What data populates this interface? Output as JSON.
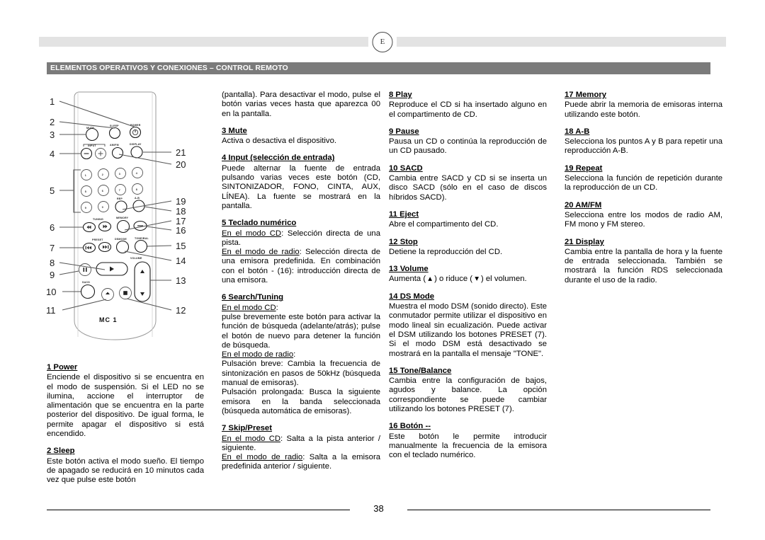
{
  "page": {
    "language_mark": "E",
    "section_title": "ELEMENTOS OPERATIVOS Y CONEXIONES – CONTROL REMOTO",
    "page_number": "38"
  },
  "figure": {
    "model_label": "MC 1",
    "callouts_left": [
      "1",
      "2",
      "3",
      "4",
      "5",
      "6",
      "7",
      "8",
      "9",
      "10",
      "11"
    ],
    "callouts_right": [
      "21",
      "20",
      "19",
      "18",
      "17",
      "16",
      "15",
      "14",
      "13",
      "12"
    ],
    "button_labels": {
      "mute": "MUTE",
      "sleep": "SLEEP",
      "power": "POWER",
      "input": "INPUT",
      "amfm": "AM/FM",
      "display": "DISPLAY",
      "rep": "REP",
      "ab": "A-B",
      "tuning": "TUNING",
      "memory": "MEMORY",
      "preset": "PRESET",
      "dsmode": "DSMODE",
      "tonebal": "TONE/BAL",
      "volume": "VOLUME",
      "sacd": "SACD",
      "minus": "-",
      "keys": [
        "1",
        "2",
        "3",
        "4",
        "5",
        "6",
        "7",
        "8",
        "9",
        "0"
      ],
      "input_minus": "−",
      "input_plus": "+"
    }
  },
  "columns": {
    "col1": {
      "entries": [
        {
          "title": "1  Power",
          "body": "Enciende el dispositivo si se encuentra en el modo de suspensión. Si el LED no se ilumina, accione el interruptor de alimentación que se encuentra en la parte posterior del dispositivo. De igual forma, le permite apagar el dispositivo si está encendido."
        },
        {
          "title": "2  Sleep",
          "body": "Este botón activa el modo sueño. El tiempo de apagado se reducirá en 10 minutos cada vez que pulse este botón"
        }
      ]
    },
    "col2": {
      "lead_text": "(pantalla). Para desactivar el modo, pulse el botón varias veces hasta que aparezca 00 en la pantalla.",
      "entries": [
        {
          "title": "3  Mute",
          "body": "Activa o desactiva el dispositivo."
        },
        {
          "title": "4  Input (selección de entrada)",
          "body": "Puede alternar la fuente de entrada pulsando varias veces este botón (CD, SINTONIZADOR, FONO, CINTA, AUX, LÍNEA). La fuente se mostrará en la pantalla."
        },
        {
          "title": "5 Teclado numérico",
          "sub1": "En el modo CD",
          "body1": ": Selección directa de una pista.",
          "sub2": "En el modo de radio",
          "body2": ": Selección directa de una emisora predefinida. En combinación con el botón - (16): introducción directa de una emisora."
        },
        {
          "title": "6  Search/Tuning",
          "sub1": "En el modo CD",
          "body1": ":",
          "para1": "pulse brevemente este botón para activar la función de búsqueda (adelante/atrás); pulse el botón de nuevo para detener la función de búsqueda.",
          "sub2": "En el modo de radio",
          "body2": ":",
          "para2": "Pulsación breve: Cambia la frecuencia de sintonización en pasos de 50kHz (búsqueda manual de emisoras).",
          "para3": "Pulsación prolongada: Busca la siguiente emisora en la banda seleccionada (búsqueda automática de emisoras)."
        },
        {
          "title": "7  Skip/Preset",
          "sub1": "En el modo CD",
          "body1": ": Salta a la pista anterior / siguiente.",
          "sub2": "En el modo de radio",
          "body2": ": Salta a la emisora predefinida anterior / siguiente."
        }
      ]
    },
    "col3": {
      "entries": [
        {
          "title": "8  Play",
          "body": "Reproduce el CD si ha insertado alguno en el compartimento de CD."
        },
        {
          "title": "9  Pause",
          "body": "Pausa un CD o continúa la reproducción de un CD pausado."
        },
        {
          "title": "10  SACD",
          "body": "Cambia entre SACD y CD si se inserta un disco SACD (sólo en el caso de discos híbridos SACD)."
        },
        {
          "title": "11  Eject",
          "body": "Abre el compartimento del CD."
        },
        {
          "title": "12  Stop",
          "body": "Detiene la reproducción del CD."
        },
        {
          "title": "13  Volume",
          "body": "Aumenta ( ▴ ) o riduce ( ▾ ) el volumen."
        },
        {
          "title": "14  DS Mode",
          "body": "Muestra el modo DSM (sonido directo). Este conmutador permite utilizar el dispositivo en modo lineal sin ecualización. Puede activar el DSM utilizando los botones PRESET (7). Si el modo DSM está desactivado se mostrará en la pantalla el mensaje \"TONE\"."
        },
        {
          "title": "15 Tone/Balance",
          "body": "Cambia entre la configuración de bajos, agudos y balance. La opción correspondiente se puede cambiar utilizando los botones PRESET (7)."
        },
        {
          "title": "16  Botón --",
          "body": "Este botón le permite introducir manualmente la frecuencia de la emisora con el teclado numérico."
        }
      ]
    },
    "col4": {
      "entries": [
        {
          "title": "17  Memory",
          "body": "Puede abrir la memoria de emisoras interna utilizando este botón."
        },
        {
          "title": "18  A-B",
          "body": "Selecciona los puntos A y B para repetir una reproducción A-B."
        },
        {
          "title": "19  Repeat",
          "body": "Selecciona la función de repetición durante la reproducción de un CD."
        },
        {
          "title": "20  AM/FM",
          "body": "Selecciona entre los modos de radio AM, FM mono y FM stereo."
        },
        {
          "title": "21  Display",
          "body": "Cambia entre la pantalla de hora y la fuente de entrada seleccionada. También se mostrará la función RDS seleccionada durante el uso de la radio."
        }
      ]
    }
  }
}
